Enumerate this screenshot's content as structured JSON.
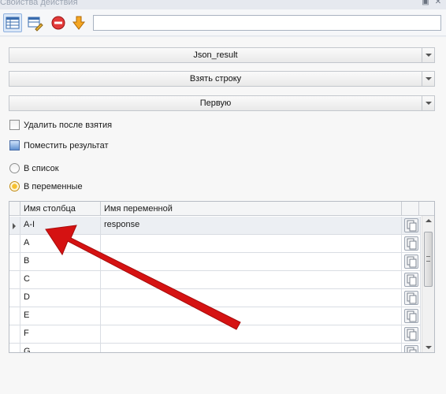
{
  "window": {
    "title": "Свойства действия",
    "pin_glyph": "▣",
    "close_glyph": "✕"
  },
  "toolbar": {
    "buttons": [
      {
        "icon": "table-icon",
        "active": true
      },
      {
        "icon": "edit-table-icon",
        "active": false
      },
      {
        "icon": "stop-icon",
        "active": false
      },
      {
        "icon": "arrow-down-icon",
        "active": false
      }
    ],
    "input_value": ""
  },
  "selects": {
    "source": "Json_result",
    "action": "Взять строку",
    "which": "Первую"
  },
  "options": {
    "delete_after": {
      "label": "Удалить после взятия",
      "checked": false
    },
    "put_result": {
      "label": "Поместить результат"
    },
    "to_list": {
      "label": "В список",
      "selected": false
    },
    "to_vars": {
      "label": "В переменные",
      "selected": true
    }
  },
  "grid": {
    "headers": [
      "Имя столбца",
      "Имя переменной"
    ],
    "rows": [
      {
        "column": "A-I",
        "variable": "response"
      },
      {
        "column": "A",
        "variable": ""
      },
      {
        "column": "B",
        "variable": ""
      },
      {
        "column": "C",
        "variable": ""
      },
      {
        "column": "D",
        "variable": ""
      },
      {
        "column": "E",
        "variable": ""
      },
      {
        "column": "F",
        "variable": ""
      },
      {
        "column": "G",
        "variable": ""
      }
    ],
    "current_row": 0
  },
  "colors": {
    "annotation_arrow": "#d51212",
    "radio_selected": "#f6c030",
    "toolbar_active": "#dbe8f8"
  }
}
